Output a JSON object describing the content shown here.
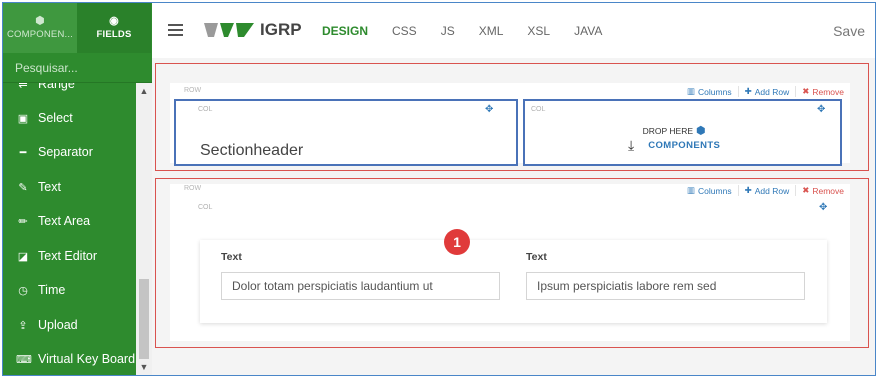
{
  "sidebar": {
    "tabs": [
      {
        "label": "COMPONEN...",
        "icon": "cube-icon",
        "active": false
      },
      {
        "label": "FIELDS",
        "icon": "circle-dot-icon",
        "active": true
      }
    ],
    "search_placeholder": "Pesquisar...",
    "items": [
      {
        "label": "Range",
        "icon": "range-icon"
      },
      {
        "label": "Select",
        "icon": "select-icon"
      },
      {
        "label": "Separator",
        "icon": "separator-icon"
      },
      {
        "label": "Text",
        "icon": "edit-icon"
      },
      {
        "label": "Text Area",
        "icon": "pencil-icon"
      },
      {
        "label": "Text Editor",
        "icon": "text-editor-icon"
      },
      {
        "label": "Time",
        "icon": "clock-icon"
      },
      {
        "label": "Upload",
        "icon": "upload-icon"
      },
      {
        "label": "Virtual Key Board",
        "icon": "keyboard-icon"
      }
    ]
  },
  "header": {
    "brand": "IGRP",
    "menu": [
      "DESIGN",
      "CSS",
      "JS",
      "XML",
      "XSL",
      "JAVA"
    ],
    "active_menu": "DESIGN",
    "save_label": "Save"
  },
  "canvas": {
    "row_label": "ROW",
    "col_label": "COL",
    "tools": {
      "columns": "Columns",
      "add_row": "Add Row",
      "remove": "Remove"
    },
    "row1": {
      "section_header": "Sectionheader",
      "drop_here": "DROP HERE",
      "components_link": "COMPONENTS"
    },
    "row2": {
      "badge": "1",
      "fields": [
        {
          "label": "Text",
          "value": "Dolor totam perspiciatis laudantium ut"
        },
        {
          "label": "Text",
          "value": "Ipsum perspiciatis labore rem sed"
        }
      ]
    }
  },
  "colors": {
    "sidebar_green": "#2e8b2e",
    "accent_blue": "#2f78b7",
    "highlight_red": "#d9534f",
    "select_blue": "#4a72b8"
  }
}
